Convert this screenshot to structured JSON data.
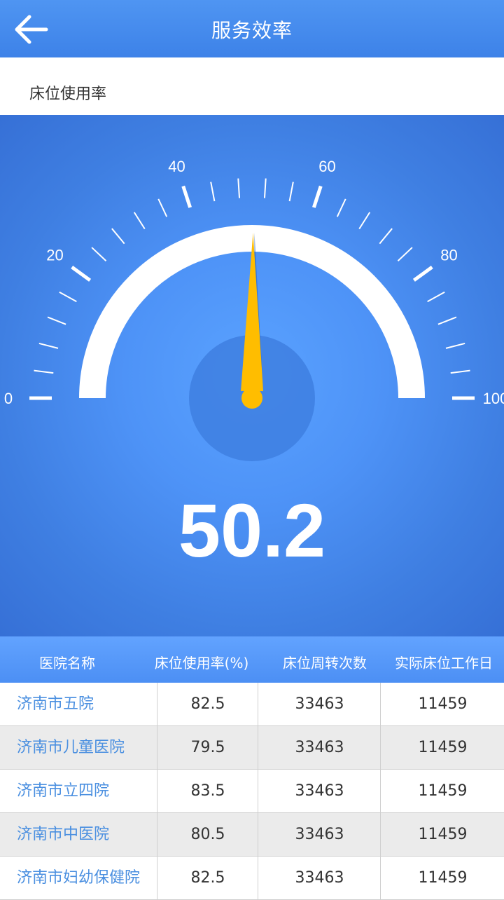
{
  "header": {
    "title": "服务效率",
    "back_icon": "arrow-left-icon"
  },
  "subheader": {
    "label": "床位使用率"
  },
  "gauge": {
    "value": 50.2,
    "value_text": "50.2",
    "min": 0,
    "max": 100,
    "tick_labels": [
      "0",
      "20",
      "40",
      "60",
      "80",
      "100"
    ],
    "needle_color": "#ffbd00",
    "arc_color": "#ffffff"
  },
  "table": {
    "headers": [
      "医院名称",
      "床位使用率(%)",
      "床位周转次数",
      "实际床位工作日"
    ],
    "rows": [
      {
        "name": "济南市五院",
        "rate": "82.5",
        "turnover": "33463",
        "workdays": "11459"
      },
      {
        "name": "济南市儿童医院",
        "rate": "79.5",
        "turnover": "33463",
        "workdays": "11459"
      },
      {
        "name": "济南市立四院",
        "rate": "83.5",
        "turnover": "33463",
        "workdays": "11459"
      },
      {
        "name": "济南市中医院",
        "rate": "80.5",
        "turnover": "33463",
        "workdays": "11459"
      },
      {
        "name": "济南市妇幼保健院",
        "rate": "82.5",
        "turnover": "33463",
        "workdays": "11459"
      }
    ]
  }
}
